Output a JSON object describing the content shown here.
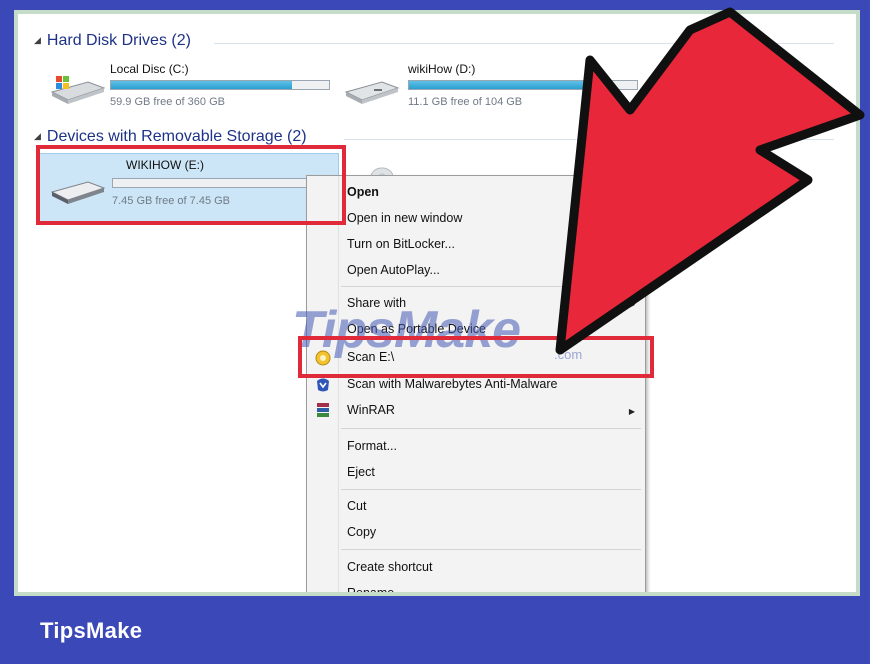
{
  "explorer": {
    "hard_disk_section": "Hard Disk Drives (2)",
    "removable_section": "Devices with Removable Storage (2)",
    "drives": [
      {
        "name": "Local Disc (C:)",
        "free_text": "59.9 GB free of 360 GB",
        "used_fraction": 0.83,
        "icon": "hard-drive-windows-icon"
      },
      {
        "name": "wikiHow (D:)",
        "free_text": "11.1 GB free of 104 GB",
        "used_fraction": 0.89,
        "icon": "hard-drive-icon"
      },
      {
        "name": "WIKIHOW (E:)",
        "free_text": "7.45 GB free of 7.45 GB",
        "used_fraction": 0.0,
        "icon": "removable-drive-icon"
      }
    ]
  },
  "context_menu": {
    "items": {
      "open": "Open",
      "open_new_window": "Open in new window",
      "bitlocker": "Turn on BitLocker...",
      "autoplay": "Open AutoPlay...",
      "share_with": "Share with",
      "portable_device": "Open as Portable Device",
      "scan": "Scan E:\\",
      "malwarebytes": "Scan with Malwarebytes Anti-Malware",
      "winrar": "WinRAR",
      "format": "Format...",
      "eject": "Eject",
      "cut": "Cut",
      "copy": "Copy",
      "create_shortcut": "Create shortcut",
      "rename": "Rename"
    }
  },
  "watermark": {
    "text": "TipsMake",
    "suffix": ".com"
  },
  "footer": {
    "brand": "TipsMake"
  },
  "colors": {
    "frame_blue": "#3a48b8",
    "highlight_red": "#e02a3a",
    "arrow_red": "#e8283a",
    "bar_blue": "#2a9fd0",
    "selection_blue": "#cde6f7"
  }
}
